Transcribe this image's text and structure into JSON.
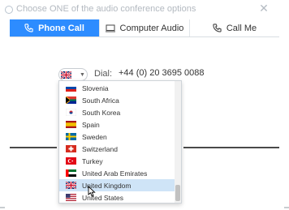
{
  "window": {
    "title": "Choose ONE of the audio conference options",
    "close_icon": "close-icon"
  },
  "tabs": [
    {
      "label": "Phone Call",
      "icon": "phone-icon",
      "active": true
    },
    {
      "label": "Computer Audio",
      "icon": "monitor-icon",
      "active": false
    },
    {
      "label": "Call Me",
      "icon": "phone-icon",
      "active": false
    }
  ],
  "dial": {
    "label": "Dial:",
    "number": "+44 (0) 20 3695 0088",
    "selected_country_flag": "uk-flag-icon"
  },
  "dropdown": {
    "items": [
      {
        "name": "Slovenia",
        "flag": "slovenia-flag-icon"
      },
      {
        "name": "South Africa",
        "flag": "south-africa-flag-icon"
      },
      {
        "name": "South Korea",
        "flag": "south-korea-flag-icon"
      },
      {
        "name": "Spain",
        "flag": "spain-flag-icon"
      },
      {
        "name": "Sweden",
        "flag": "sweden-flag-icon"
      },
      {
        "name": "Switzerland",
        "flag": "switzerland-flag-icon"
      },
      {
        "name": "Turkey",
        "flag": "turkey-flag-icon"
      },
      {
        "name": "United Arab Emirates",
        "flag": "uae-flag-icon"
      },
      {
        "name": "United Kingdom",
        "flag": "uk-flag-icon",
        "selected": true
      },
      {
        "name": "United States",
        "flag": "us-flag-icon"
      }
    ]
  },
  "colors": {
    "accent": "#2d8cff",
    "selected_row": "#cfe4f7"
  }
}
